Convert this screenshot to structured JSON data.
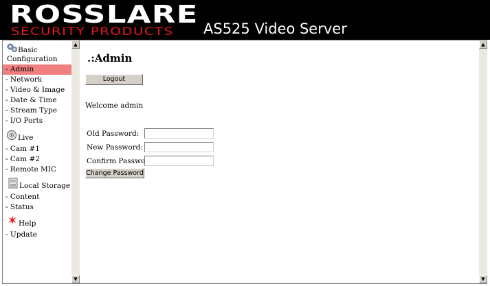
{
  "header": {
    "brand": "ROSSLARE",
    "brand_sub": "SECURITY PRODUCTS",
    "product": "AS525 Video Server"
  },
  "sidebar": {
    "sections": [
      {
        "icon": "gears-icon",
        "label_line1": "Basic",
        "label_line2": "Configuration",
        "items": [
          "- Admin",
          "- Network",
          "- Video & Image",
          "- Date & Time",
          "- Stream Type",
          "- I/O Ports"
        ]
      },
      {
        "icon": "camera-icon",
        "label": "Live",
        "items": [
          "- Cam #1",
          "- Cam #2",
          "- Remote MIC"
        ]
      },
      {
        "icon": "storage-icon",
        "label": "Local Storage",
        "items": [
          "- Content",
          "- Status"
        ]
      },
      {
        "icon": "help-icon",
        "label": "Help",
        "items": [
          "- Update"
        ]
      }
    ],
    "active_item": "- Admin"
  },
  "main": {
    "title": ".:Admin",
    "logout_label": "Logout",
    "welcome": "Welcome admin",
    "form": {
      "old_password_label": "Old Password:",
      "new_password_label": "New Password:",
      "confirm_password_label": "Confirm Password:",
      "old_password_value": "",
      "new_password_value": "",
      "confirm_password_value": "",
      "submit_label": "Change Password"
    }
  },
  "colors": {
    "header_bg": "#000000",
    "brand_red": "#e01818",
    "active_item_bg": "#f08080",
    "button_face": "#d4d0c8"
  }
}
